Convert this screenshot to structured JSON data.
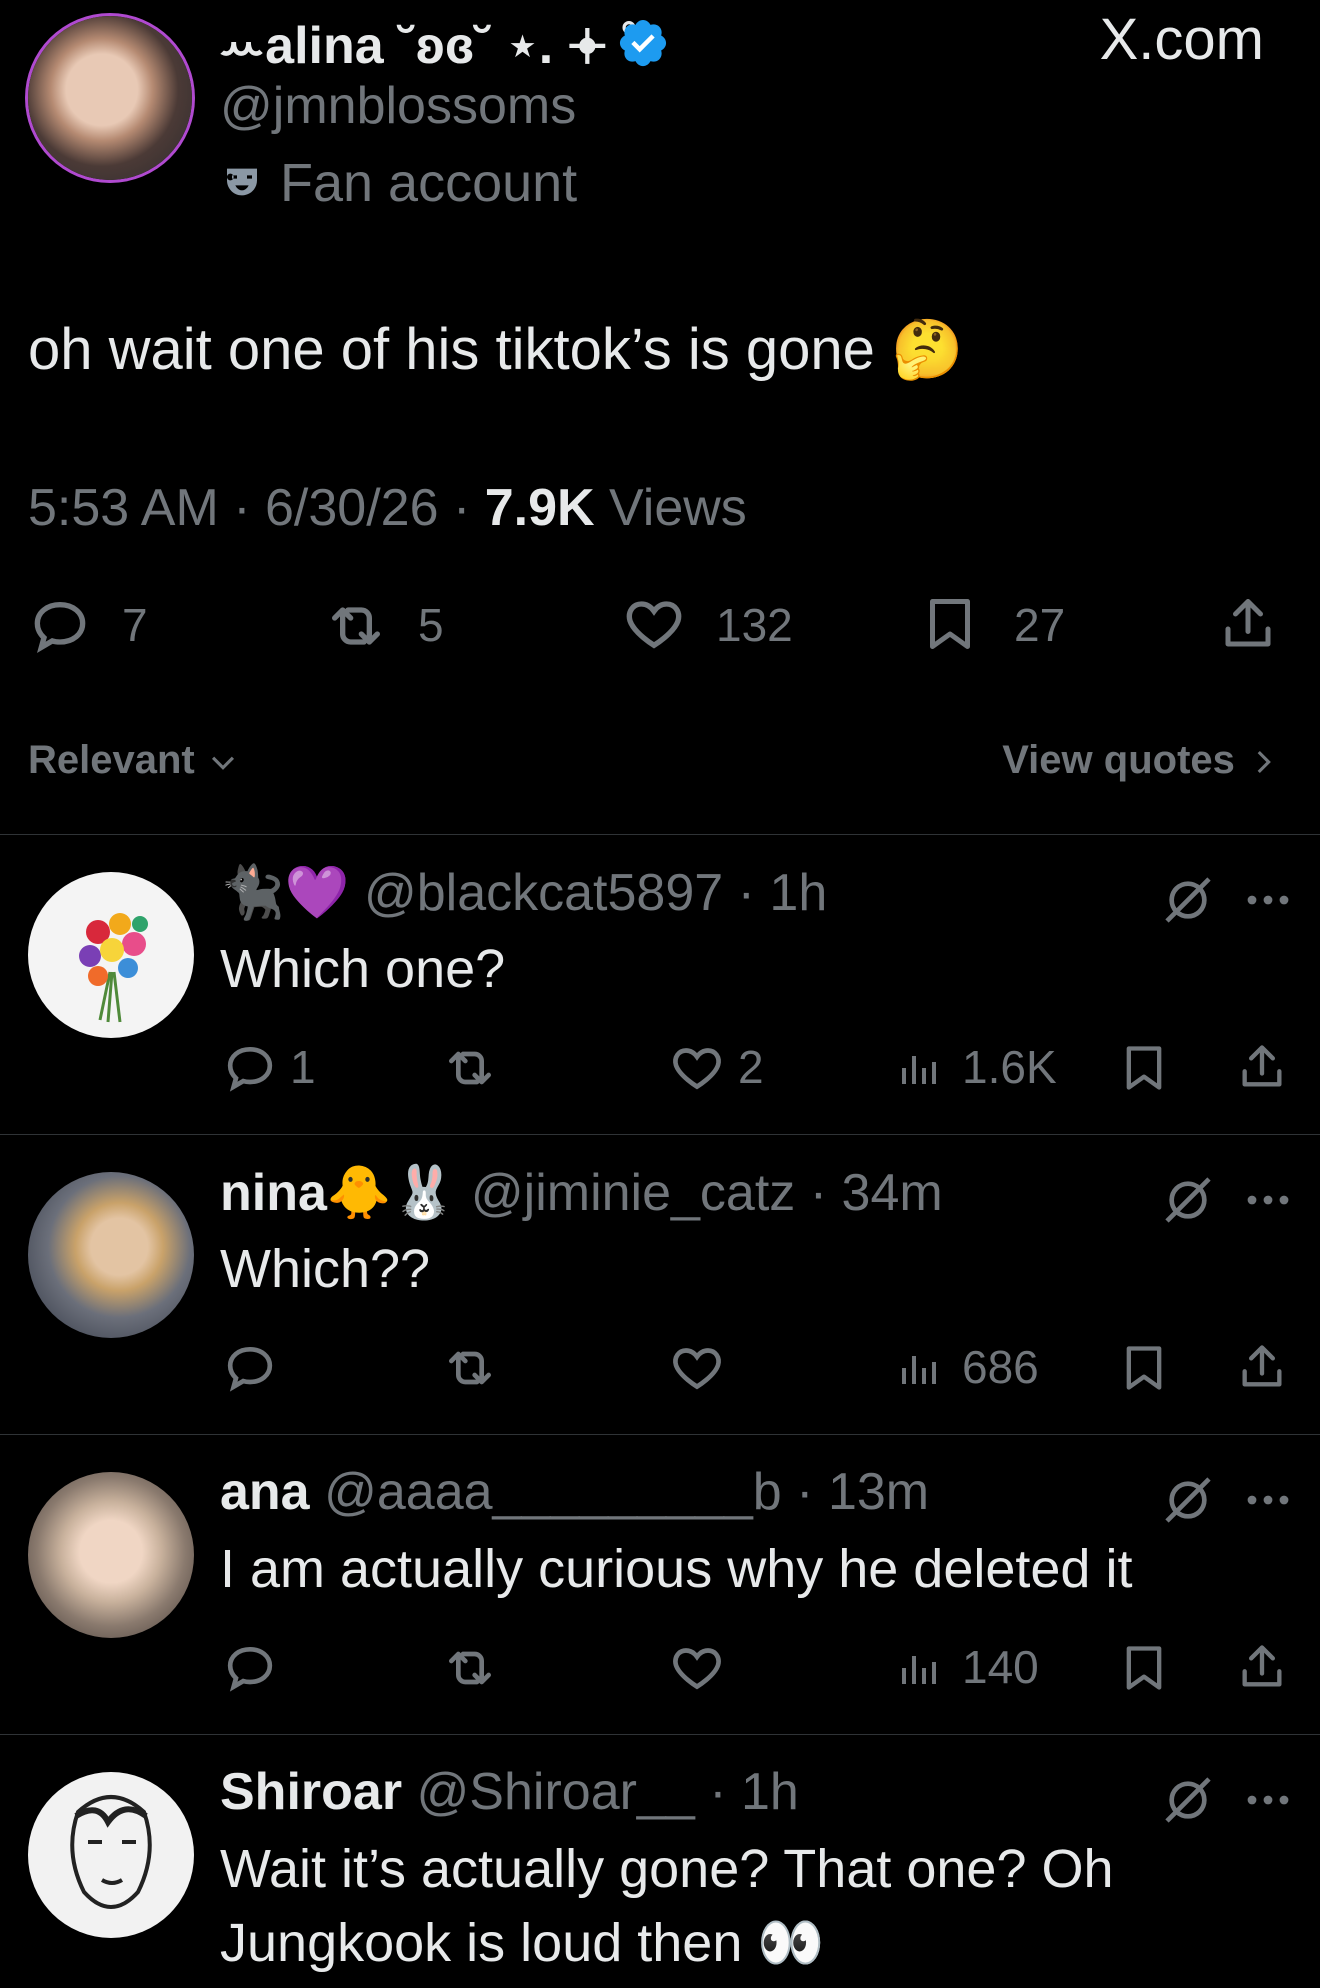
{
  "main_tweet": {
    "display_name": "ꕀalina ˘ʚɞ˘ ⋆. 𖥔 ˚",
    "handle": "@jmnblossoms",
    "affiliation": "Fan account",
    "site_label": "X.com",
    "text": "oh wait one of his tiktok’s is gone 🤔",
    "time": "5:53 AM",
    "date": "6/30/26",
    "views_count": "7.9K",
    "views_label": "Views",
    "replies": "7",
    "reposts": "5",
    "likes": "132",
    "bookmarks": "27"
  },
  "sort": {
    "label": "Relevant",
    "view_quotes": "View quotes"
  },
  "replies": [
    {
      "name_emojis": "🐈‍⬛💜",
      "name": "",
      "handle": "@blackcat5897",
      "time": "1h",
      "text": "Which one?",
      "replies": "1",
      "reposts": "",
      "likes": "2",
      "views": "1.6K"
    },
    {
      "name": "nina",
      "name_emojis": "🐥🐰",
      "handle": "@jiminie_catz",
      "time": "34m",
      "text": "Which??",
      "replies": "",
      "reposts": "",
      "likes": "",
      "views": "686"
    },
    {
      "name": "ana",
      "name_emojis": "",
      "handle": "@aaaa_________b",
      "time": "13m",
      "text": "I am actually curious why he deleted it",
      "replies": "",
      "reposts": "",
      "likes": "",
      "views": "140"
    },
    {
      "name": "Shiroar",
      "name_emojis": "",
      "handle": "@Shiroar__",
      "time": "1h",
      "text_line1": "Wait it’s actually gone? That one? Oh",
      "text_line2": "Jungkook is loud then 👀",
      "replies": "",
      "reposts": "",
      "likes": "",
      "views": ""
    }
  ],
  "colors": {
    "background": "#000000",
    "text": "#e7e9ea",
    "secondary": "#71767b",
    "verified": "#1d9bf0",
    "divider": "#2f3336"
  },
  "icons": [
    "verified-badge-icon",
    "fan-account-mask-icon",
    "reply-icon",
    "repost-icon",
    "like-icon",
    "bookmark-icon",
    "share-icon",
    "views-icon",
    "grok-icon",
    "more-icon",
    "chevron-down-icon",
    "chevron-right-icon"
  ]
}
